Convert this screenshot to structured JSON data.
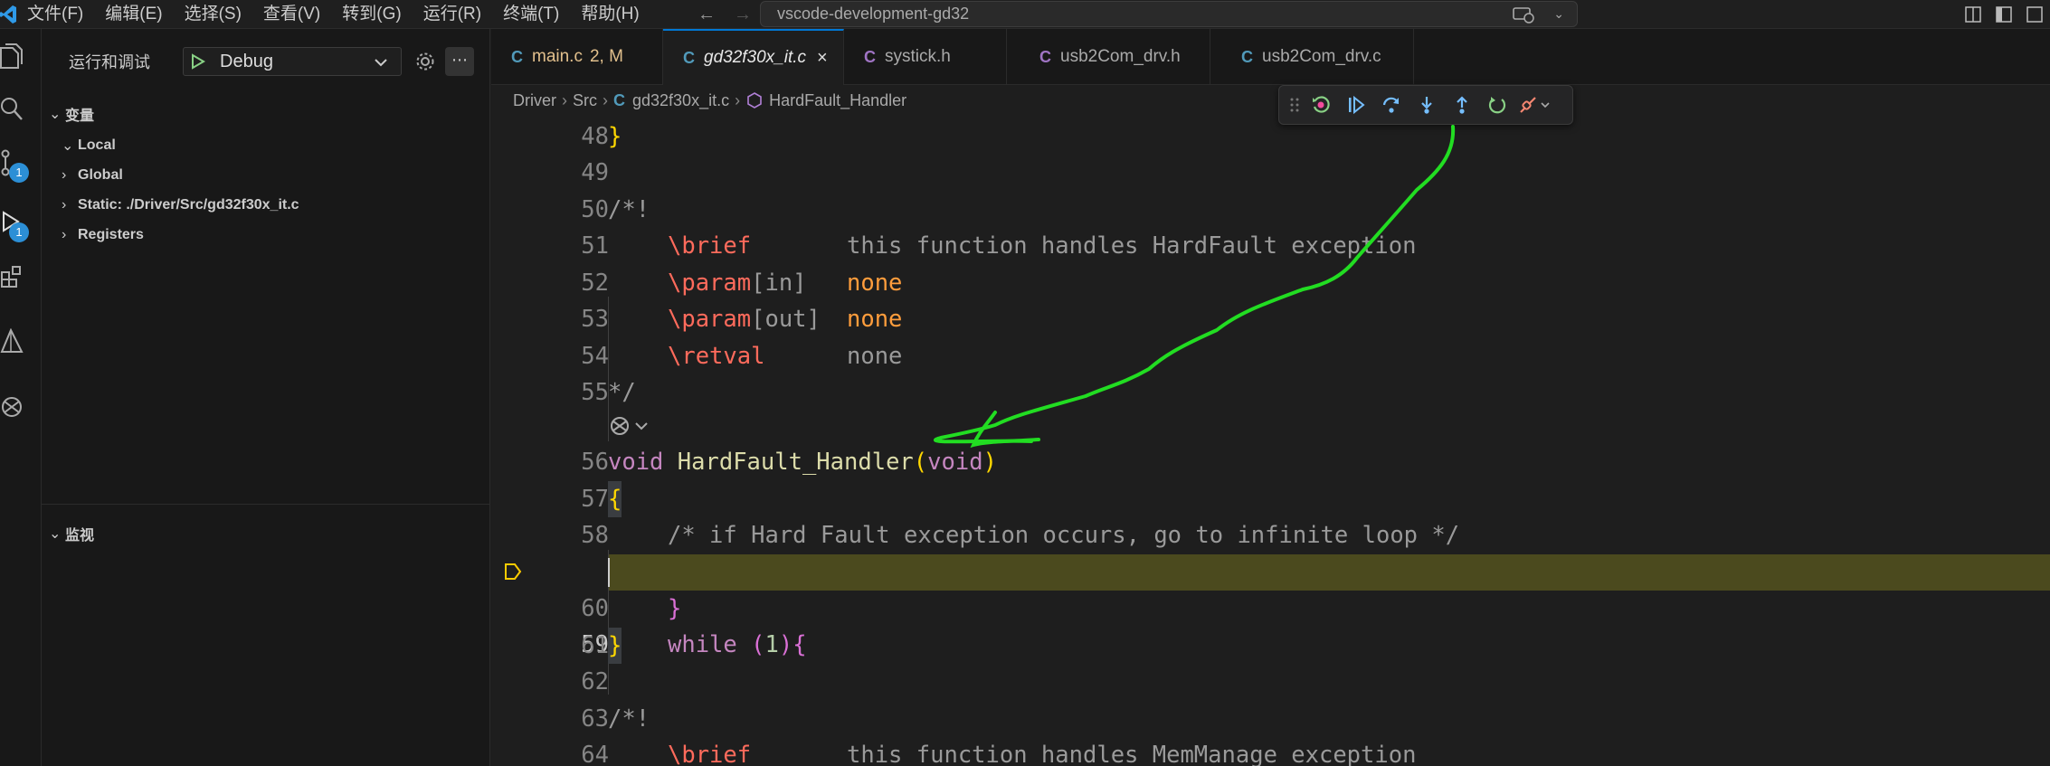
{
  "menu": [
    "文件(F)",
    "编辑(E)",
    "选择(S)",
    "查看(V)",
    "转到(G)",
    "运行(R)",
    "终端(T)",
    "帮助(H)"
  ],
  "command_center": {
    "text": "vscode-development-gd32"
  },
  "activity_bar": {
    "badges": [
      "1",
      "1"
    ]
  },
  "sidebar": {
    "title": "运行和调试",
    "config": "Debug",
    "sections": {
      "variables": "变量",
      "watch": "监视"
    },
    "variables": [
      "Local",
      "Global",
      "Static: ./Driver/Src/gd32f30x_it.c",
      "Registers"
    ]
  },
  "tabs": [
    {
      "label": "main.c",
      "suffix": "2, M",
      "icon": "C",
      "color": "#f0a33a"
    },
    {
      "label": "gd32f30x_it.c",
      "suffix": "",
      "icon": "C",
      "color": "#e0e0e0"
    },
    {
      "label": "systick.h",
      "suffix": "",
      "icon": "C",
      "color": "#a074c4"
    },
    {
      "label": "usb2Com_drv.h",
      "suffix": "",
      "icon": "C",
      "color": "#a074c4"
    },
    {
      "label": "usb2Com_drv.c",
      "suffix": "",
      "icon": "C",
      "color": "#519aba"
    }
  ],
  "breadcrumb": [
    "Driver",
    "Src",
    "gd32f30x_it.c",
    "HardFault_Handler"
  ],
  "editor": {
    "line_numbers": [
      "48",
      "49",
      "50",
      "51",
      "52",
      "53",
      "54",
      "55",
      "56",
      "57",
      "58",
      "59",
      "60",
      "61",
      "62",
      "63",
      "64"
    ],
    "current_line": "59",
    "lines": {
      "l48": "}",
      "l50": "/*!",
      "l51_tag": "\\brief",
      "l51_text": "this function handles HardFault exception",
      "l52_tag": "\\param",
      "l52_b": "[in]",
      "l52_val": "none",
      "l53_tag": "\\param",
      "l53_b": "[out]",
      "l53_val": "none",
      "l54_tag": "\\retval",
      "l54_text": "none",
      "l55": "*/",
      "l56_kw": "void",
      "l56_fn": "HardFault_Handler",
      "l56_p1": "(",
      "l56_arg": "void",
      "l56_p2": ")",
      "l57": "{",
      "l58": "/* if Hard Fault exception occurs, go to infinite loop */",
      "l59_kw": "while",
      "l59_p1": "(",
      "l59_num": "1",
      "l59_p2": "){",
      "l60": "}",
      "l61": "}",
      "l63": "/*!",
      "l64_tag": "\\brief",
      "l64_text": "this function handles MemManage exception"
    }
  },
  "annotation": {
    "arrow_color": "#22dd22"
  }
}
